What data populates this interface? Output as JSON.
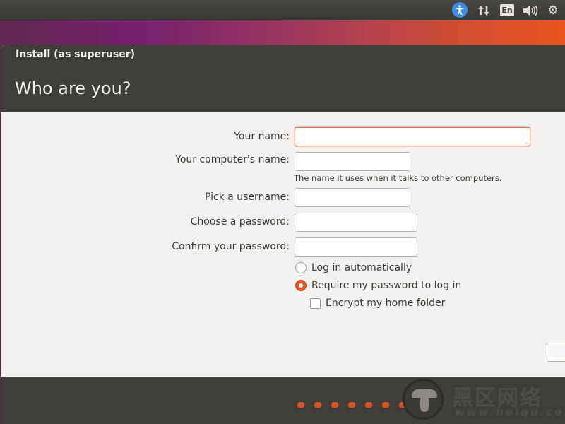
{
  "panel": {
    "keyboard_layout": "En",
    "icons": [
      "accessibility-icon",
      "network-icon",
      "keyboard-layout-indicator",
      "volume-icon",
      "gear-icon"
    ]
  },
  "window": {
    "title": "Install (as superuser)",
    "heading": "Who are you?"
  },
  "form": {
    "your_name_label": "Your name:",
    "your_name_value": "",
    "computer_name_label": "Your computer's name:",
    "computer_name_value": "",
    "computer_name_hint": "The name it uses when it talks to other computers.",
    "username_label": "Pick a username:",
    "username_value": "",
    "password_label": "Choose a password:",
    "confirm_label": "Confirm your password:",
    "login_auto_label": "Log in automatically",
    "require_password_label": "Require my password to log in",
    "encrypt_home_label": "Encrypt my home folder",
    "selected_login_option": "require_password",
    "encrypt_home_checked": false
  },
  "footer": {
    "progress_dots": 7
  },
  "watermark": {
    "text": "黑区网络",
    "subtext": "www.heiqu.com"
  },
  "colors": {
    "accent": "#e95420",
    "header_bg": "#403e3a",
    "window_bg": "#f2f1f0",
    "a11y_blue": "#3e8ee8"
  }
}
